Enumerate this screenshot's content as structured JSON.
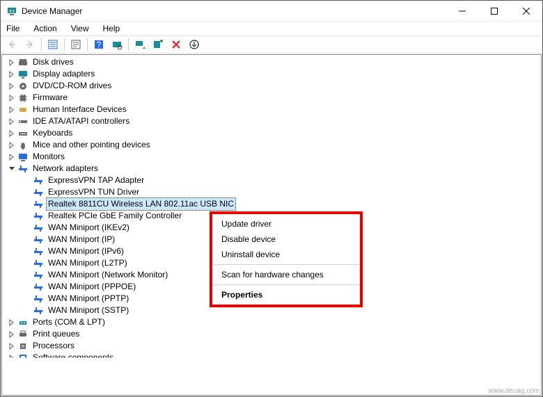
{
  "window": {
    "title": "Device Manager"
  },
  "menu": {
    "file": "File",
    "action": "Action",
    "view": "View",
    "help": "Help"
  },
  "watermark": "www.deuaq.com",
  "context": {
    "update": "Update driver",
    "disable": "Disable device",
    "uninstall": "Uninstall device",
    "scan": "Scan for hardware changes",
    "properties": "Properties"
  },
  "tree": {
    "items": [
      {
        "label": "Disk drives",
        "expanded": false,
        "icon": "disk"
      },
      {
        "label": "Display adapters",
        "expanded": false,
        "icon": "display"
      },
      {
        "label": "DVD/CD-ROM drives",
        "expanded": false,
        "icon": "dvd"
      },
      {
        "label": "Firmware",
        "expanded": false,
        "icon": "chip"
      },
      {
        "label": "Human Interface Devices",
        "expanded": false,
        "icon": "hid"
      },
      {
        "label": "IDE ATA/ATAPI controllers",
        "expanded": false,
        "icon": "ide"
      },
      {
        "label": "Keyboards",
        "expanded": false,
        "icon": "keyboard"
      },
      {
        "label": "Mice and other pointing devices",
        "expanded": false,
        "icon": "mouse"
      },
      {
        "label": "Monitors",
        "expanded": false,
        "icon": "monitor"
      },
      {
        "label": "Network adapters",
        "expanded": true,
        "icon": "net",
        "children": [
          {
            "label": "ExpressVPN TAP Adapter",
            "icon": "net"
          },
          {
            "label": "ExpressVPN TUN Driver",
            "icon": "net"
          },
          {
            "label": "Realtek 8811CU Wireless LAN 802.11ac USB NIC",
            "icon": "net",
            "selected": true
          },
          {
            "label": "Realtek PCIe GbE Family Controller",
            "icon": "net"
          },
          {
            "label": "WAN Miniport (IKEv2)",
            "icon": "net"
          },
          {
            "label": "WAN Miniport (IP)",
            "icon": "net"
          },
          {
            "label": "WAN Miniport (IPv6)",
            "icon": "net"
          },
          {
            "label": "WAN Miniport (L2TP)",
            "icon": "net"
          },
          {
            "label": "WAN Miniport (Network Monitor)",
            "icon": "net"
          },
          {
            "label": "WAN Miniport (PPPOE)",
            "icon": "net"
          },
          {
            "label": "WAN Miniport (PPTP)",
            "icon": "net"
          },
          {
            "label": "WAN Miniport (SSTP)",
            "icon": "net"
          }
        ]
      },
      {
        "label": "Ports (COM & LPT)",
        "expanded": false,
        "icon": "port"
      },
      {
        "label": "Print queues",
        "expanded": false,
        "icon": "printer"
      },
      {
        "label": "Processors",
        "expanded": false,
        "icon": "cpu"
      },
      {
        "label": "Software components",
        "expanded": false,
        "icon": "soft",
        "cut": true
      }
    ]
  }
}
